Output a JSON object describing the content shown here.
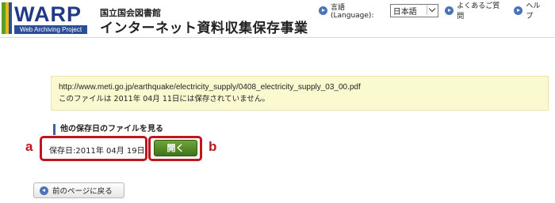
{
  "header": {
    "logo_text": "WARP",
    "logo_subtitle": "Web Archiving Project",
    "org_name": "国立国会図書館",
    "project_name": "インターネット資料収集保存事業",
    "language_label": "言語(Language):",
    "language_selected": "日本語",
    "faq_label": "よくあるご質問",
    "help_label": "ヘルプ"
  },
  "notice": {
    "url": "http://www.meti.go.jp/earthquake/electricity_supply/0408_electricity_supply_03_00.pdf",
    "message": "このファイルは 2011年 04月 11日には保存されていません。"
  },
  "other_files": {
    "heading": "他の保存日のファイルを見る",
    "date_text": "保存日:2011年 04月 19日",
    "open_label": "開く"
  },
  "annotations": {
    "a": "a",
    "b": "b"
  },
  "back_label": "前のページに戻る",
  "colors": {
    "accent_red": "#c0151d",
    "open_button_green": "#4f8a24",
    "notice_bg": "#fbf9d0",
    "link_blue": "#4a73b8"
  }
}
